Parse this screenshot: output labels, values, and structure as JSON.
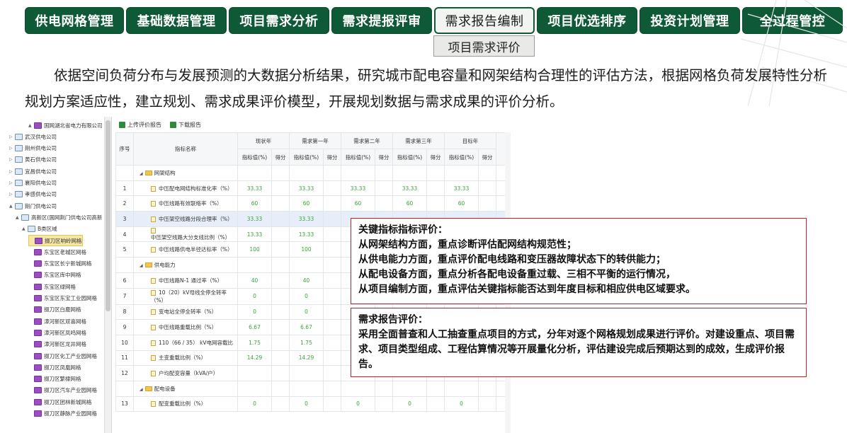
{
  "nav": {
    "tabs": [
      {
        "label": "供电网格管理",
        "active": false
      },
      {
        "label": "基础数据管理",
        "active": false
      },
      {
        "label": "项目需求分析",
        "active": false
      },
      {
        "label": "需求提报评审",
        "active": false
      },
      {
        "label": "需求报告编制",
        "active": true
      },
      {
        "label": "项目优选排序",
        "active": false
      },
      {
        "label": "投资计划管理",
        "active": false
      },
      {
        "label": "全过程管控",
        "active": false
      }
    ],
    "submenu": "项目需求评价"
  },
  "description": "依据空间负荷分布与发展预测的大数据分析结果，研究城市配电容量和网架结构合理性的评估方法，根据网格负荷发展特性分析规划方案适应性，建立规划、需求成果评价模型，开展规划数据与需求成果的评价分析。",
  "tree": [
    "国网湖北省电力有限公司",
    "武汉供电公司",
    "荆州供电公司",
    "黄石供电公司",
    "宜昌供电公司",
    "襄阳供电公司",
    "孝感供电公司",
    "荆门供电公司",
    "高新区(国网荆门供电公司高新",
    "B类区域",
    "掇刀区响岭网格",
    "东宝区老城区网格",
    "东宝区长宁新城网格",
    "东宝区库中网格",
    "东宝区绿网格",
    "东宝区东宝工业园网格",
    "掇刀区白鹿网格",
    "漳河新区双喜网格",
    "漳河新区凤鸣网格",
    "漳河新区龙井网格",
    "掇刀区化工产业园网格",
    "掇刀区凤凰网格",
    "掇刀区繁棣网格",
    "掇刀区汽车产业园网格",
    "掇刀区团林新城网格",
    "掇刀区静脉产业园网格"
  ],
  "toolbar": {
    "upload": "上传评价报告",
    "download": "下载报告"
  },
  "table": {
    "seq_header": "序号",
    "name_header": "指标名称",
    "years": [
      "现状年",
      "需求第一年",
      "需求第二年",
      "需求第三年",
      "目标年"
    ],
    "sub_value": "指标值(%)",
    "sub_score": "得分",
    "rows": [
      {
        "type": "group",
        "name": "网架结构"
      },
      {
        "type": "row",
        "seq": "1",
        "name": "中压配电网结构标准化率（%）",
        "vals": [
          "33.33",
          "33.33",
          "33.33",
          "33.33",
          "33.33"
        ]
      },
      {
        "type": "row",
        "seq": "2",
        "name": "中压线路有效联络率（%）",
        "vals": [
          "60",
          "60",
          "60",
          "60",
          "60"
        ]
      },
      {
        "type": "row",
        "seq": "3",
        "name": "中压架空线路分段合理率（%）",
        "vals": [
          "33.33",
          "33.33",
          "",
          "",
          ""
        ],
        "highlight": true
      },
      {
        "type": "row",
        "seq": "4",
        "name": "中压架空线路大分支线比例（%）",
        "vals": [
          "13.33",
          "13.33",
          "",
          "",
          ""
        ]
      },
      {
        "type": "row",
        "seq": "5",
        "name": "中压线路供电半径达标率（%）",
        "vals": [
          "100",
          "100",
          "",
          "",
          ""
        ]
      },
      {
        "type": "group",
        "name": "供电能力"
      },
      {
        "type": "row",
        "seq": "6",
        "name": "中压线路N-1 通过率（%）",
        "vals": [
          "40",
          "40",
          "",
          "",
          ""
        ]
      },
      {
        "type": "row",
        "seq": "7",
        "name": "10（20）kV母线全停全转率（%）",
        "vals": [
          "0",
          "0",
          "",
          "",
          ""
        ]
      },
      {
        "type": "row",
        "seq": "8",
        "name": "变电站全停全转率（%）",
        "vals": [
          "0",
          "0",
          "",
          "",
          ""
        ]
      },
      {
        "type": "row",
        "seq": "9",
        "name": "中压线路重载比例（%）",
        "vals": [
          "6.67",
          "6.67",
          "",
          "",
          ""
        ]
      },
      {
        "type": "row",
        "seq": "10",
        "name": "110（66 / 35） kV电网容载比",
        "vals": [
          "1.75",
          "1.75",
          "",
          "",
          ""
        ]
      },
      {
        "type": "row",
        "seq": "11",
        "name": "主变重载比例（%）",
        "vals": [
          "14.29",
          "14.29",
          "",
          "",
          ""
        ]
      },
      {
        "type": "row",
        "seq": "12",
        "name": "户均配变容量（kVA/户）",
        "vals": [
          "",
          "",
          "",
          "",
          ""
        ]
      },
      {
        "type": "group",
        "name": "配电设备"
      },
      {
        "type": "row",
        "seq": "13",
        "name": "配变重载比例（%）",
        "vals": [
          "0",
          "0",
          "0",
          "0",
          "0"
        ]
      }
    ]
  },
  "notes": {
    "key_title": "关键指标指标评价：",
    "key_lines": [
      "从网架结构方面，重点诊断评估配网结构规范性；",
      "从供电能力方面，重点评价配电线路和变压器故障状态下的转供能力；",
      "从配电设备方面，重点分析各配电设备重过载、三相不平衡的运行情况，",
      "从项目编制方面，重点评估关键指标能否达到年度目标和相应供电区域要求。"
    ],
    "report_title": "需求报告评价：",
    "report_body": "采用全面普查和人工抽查重点项目的方式，分年对逐个网格规划成果进行评价。对建设重点、项目需求、项目类型组成、工程估算情况等开展量化分析，评估建设完成后预期达到的成效，生成评价报告。"
  }
}
